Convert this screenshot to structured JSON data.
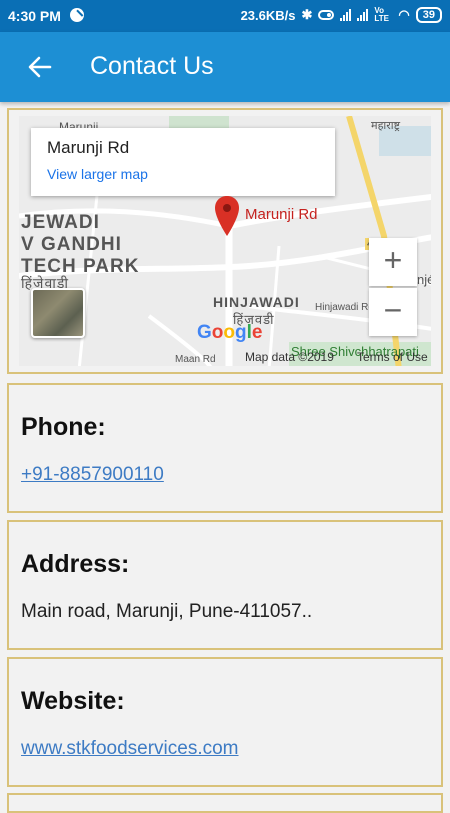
{
  "status_bar": {
    "time": "4:30 PM",
    "speed": "23.6KB/s",
    "volte": "Vo LTE",
    "battery": "39"
  },
  "app_bar": {
    "title": "Contact Us",
    "back_icon": "arrow-left-icon"
  },
  "map": {
    "place_name": "Marunji Rd",
    "larger_map_link": "View larger map",
    "pin_label": "Marunji Rd",
    "area_labels": [
      "JEWADI",
      "V GANDHI",
      "TECH PARK",
      "HINJAWADI",
      "हिंजवडी",
      "हिंजेवाडी"
    ],
    "road_labels": [
      "Hinjawadi Rd",
      "Maan Rd",
      "Marunji",
      "48"
    ],
    "bottom_label": "Shree Shivchhatrapati",
    "top_label": "महाराष्ट्र",
    "right_label": "njé",
    "google": "Google",
    "attribution": "Map data ©2019",
    "terms": "Terms of Use",
    "zoom_in": "+",
    "zoom_out": "−"
  },
  "contact": {
    "phone_heading": "Phone:",
    "phone_value": "+91-8857900110",
    "address_heading": "Address:",
    "address_value": "Main road, Marunji, Pune-411057..",
    "website_heading": "Website:",
    "website_value": "www.stkfoodservices.com"
  },
  "colors": {
    "status_bar": "#0a6fb5",
    "app_bar": "#1d8fd4",
    "card_border": "#d9c27a",
    "link": "#3d7bc4",
    "pin": "#d93025"
  }
}
